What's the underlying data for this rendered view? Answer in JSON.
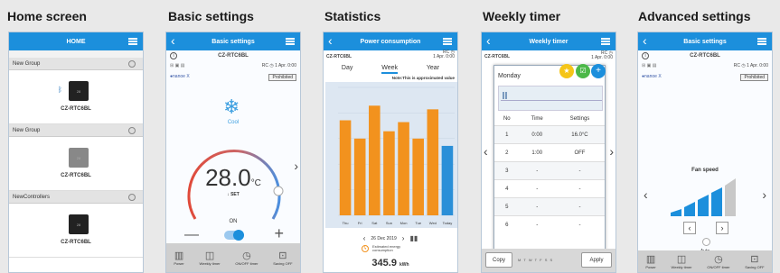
{
  "titles": [
    "Home screen",
    "Basic settings",
    "Statistics",
    "Weekly timer",
    "Advanced settings"
  ],
  "home": {
    "bar_title": "HOME",
    "groups": [
      {
        "name": "New Group",
        "device": "CZ-RTC6BL",
        "box_label": "28",
        "style": "dark",
        "bluetooth": true
      },
      {
        "name": "New Group",
        "device": "CZ-RTC6BL",
        "box_label": "28",
        "style": "grey",
        "bluetooth": false
      },
      {
        "name": "NewControllers",
        "device": "CZ-RTC6BL",
        "box_label": "28",
        "style": "dark",
        "bluetooth": false
      }
    ]
  },
  "basic": {
    "bar_title": "Basic settings",
    "device": "CZ-RTC6BL",
    "rc_time": "RC ◷ 1 Apr. 0:00",
    "prohibited": "Prohibited",
    "mode": "Cool",
    "temp": "28.0",
    "unit": "°C",
    "set_label": "SET",
    "on_label": "ON",
    "footer": [
      "Power",
      "Weekly timer",
      "ON/OFF timer",
      "Saving OFF"
    ]
  },
  "stats": {
    "bar_title": "Power consumption",
    "device": "CZ-RTC6BL",
    "rc": "RC ◷",
    "rc_time": "1 Apr. 0:00",
    "tabs": [
      "Day",
      "Week",
      "Year"
    ],
    "selected_tab": "Week",
    "note": "Note:This is approximated value",
    "date": "26 Dec 2019",
    "estimated_label": "Estimated energy consumption",
    "value": "345.9",
    "value_unit": "kWh",
    "colors": {
      "bar": "#f2921e",
      "today": "#2a8fd8",
      "bg": "#dde7f2"
    }
  },
  "chart_data": {
    "type": "bar",
    "categories": [
      "Thu",
      "Fri",
      "Sat",
      "Sun",
      "Mon",
      "Tue",
      "Wed",
      "Today"
    ],
    "values": [
      52,
      42,
      60,
      46,
      51,
      42,
      58,
      38
    ],
    "ylim": [
      0,
      70
    ],
    "title": "",
    "xlabel": "",
    "ylabel": ""
  },
  "weekly": {
    "bar_title": "Weekly timer",
    "device": "CZ-RTC6BL",
    "rc": "RC ◷",
    "rc_time": "1 Apr. 0:00",
    "day": "Monday",
    "headers": [
      "No",
      "Time",
      "Settings"
    ],
    "rows": [
      [
        "1",
        "0:00",
        "16.0°C"
      ],
      [
        "2",
        "1:00",
        "OFF"
      ],
      [
        "3",
        "-",
        "-"
      ],
      [
        "4",
        "-",
        "-"
      ],
      [
        "5",
        "-",
        "-"
      ],
      [
        "6",
        "-",
        "-"
      ]
    ],
    "copy": "Copy",
    "apply": "Apply",
    "days_short": "M T W T F S S"
  },
  "advanced": {
    "bar_title": "Basic settings",
    "device": "CZ-RTC6BL",
    "rc_time": "RC ◷ 1 Apr. 0:00",
    "prohibited": "Prohibited",
    "fan_label": "Fan speed",
    "auto_label": "Auto",
    "footer": [
      "Power",
      "Weekly timer",
      "ON/OFF timer",
      "Saving OFF"
    ]
  }
}
